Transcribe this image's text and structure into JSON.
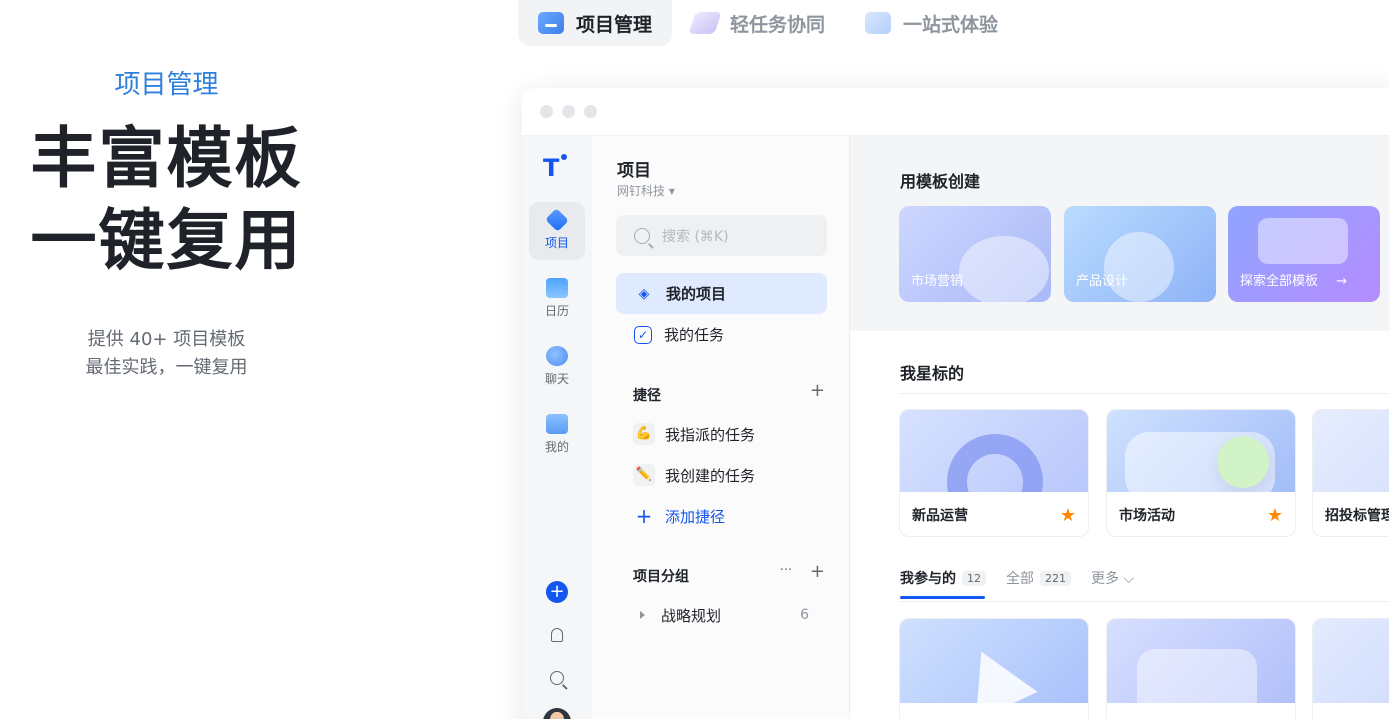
{
  "hero": {
    "kicker": "项目管理",
    "title_line1": "丰富模板",
    "title_line2": "一键复用",
    "sub_line1": "提供 40+ 项目模板",
    "sub_line2": "最佳实践，一键复用"
  },
  "top_tabs": [
    {
      "label": "项目管理",
      "icon": "folder-icon",
      "active": true
    },
    {
      "label": "轻任务协同",
      "icon": "pen-icon",
      "active": false
    },
    {
      "label": "一站式体验",
      "icon": "monitor-icon",
      "active": false
    }
  ],
  "rail": {
    "logo": "T",
    "items": [
      {
        "label": "项目",
        "icon": "project-icon",
        "active": true
      },
      {
        "label": "日历",
        "icon": "calendar-icon"
      },
      {
        "label": "聊天",
        "icon": "chat-icon"
      },
      {
        "label": "我的",
        "icon": "me-icon"
      }
    ],
    "plus": "+"
  },
  "project_panel": {
    "title": "项目",
    "org": "网钉科技 ▾",
    "search_placeholder": "搜索 (⌘K)",
    "nav": [
      {
        "label": "我的项目",
        "icon": "layers-icon",
        "active": true
      },
      {
        "label": "我的任务",
        "icon": "checkbox-icon"
      }
    ],
    "shortcuts_title": "捷径",
    "shortcuts": [
      {
        "label": "我指派的任务",
        "emoji": "💪"
      },
      {
        "label": "我创建的任务",
        "emoji": "✏️"
      }
    ],
    "add_shortcut": "添加捷径",
    "groups_title": "项目分组",
    "group_tools": "···",
    "plus": "+",
    "groups": [
      {
        "label": "战略规划",
        "count": "6"
      }
    ]
  },
  "main": {
    "template_title": "用模板创建",
    "templates": [
      {
        "label": "市场营销"
      },
      {
        "label": "产品设计"
      },
      {
        "label": "探索全部模板"
      }
    ],
    "template_arrow": "→",
    "starred_title": "我星标的",
    "starred": [
      {
        "label": "新品运营"
      },
      {
        "label": "市场活动"
      },
      {
        "label": "招投标管理"
      }
    ],
    "star_glyph": "★",
    "tabs": [
      {
        "label": "我参与的",
        "count": "12",
        "active": true
      },
      {
        "label": "全部",
        "count": "221"
      },
      {
        "label": "更多 ⌵"
      }
    ]
  },
  "colors": {
    "accent": "#1456f0",
    "hero_kicker": "#2f7fdc",
    "star": "#ff8800"
  }
}
